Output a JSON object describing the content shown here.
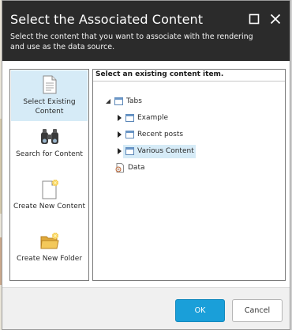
{
  "dialog": {
    "title": "Select the Associated Content",
    "subtitle": "Select the content that you want to associate with the rendering and use as the data source.",
    "maximize_icon": "maximize-icon",
    "close_icon": "close-icon"
  },
  "nav": {
    "items": [
      {
        "label": "Select Existing Content",
        "icon": "document-icon",
        "selected": true
      },
      {
        "label": "Search for Content",
        "icon": "binoculars-icon",
        "selected": false
      },
      {
        "label": "Create New Content",
        "icon": "new-document-icon",
        "selected": false
      },
      {
        "label": "Create New Folder",
        "icon": "new-folder-icon",
        "selected": false
      }
    ]
  },
  "content": {
    "header": "Select an existing content item.",
    "tree": {
      "root": {
        "label": "Tabs",
        "expanded": true
      },
      "children": [
        {
          "label": "Example",
          "collapsed": true
        },
        {
          "label": "Recent posts",
          "collapsed": true
        },
        {
          "label": "Various Content",
          "collapsed": true,
          "selected": true
        }
      ],
      "data": {
        "label": "Data"
      }
    }
  },
  "footer": {
    "ok_label": "OK",
    "cancel_label": "Cancel"
  },
  "colors": {
    "header_bg": "#2b2b2b",
    "selected_bg": "#d6ebf7",
    "ok_bg": "#1a9fd9"
  }
}
